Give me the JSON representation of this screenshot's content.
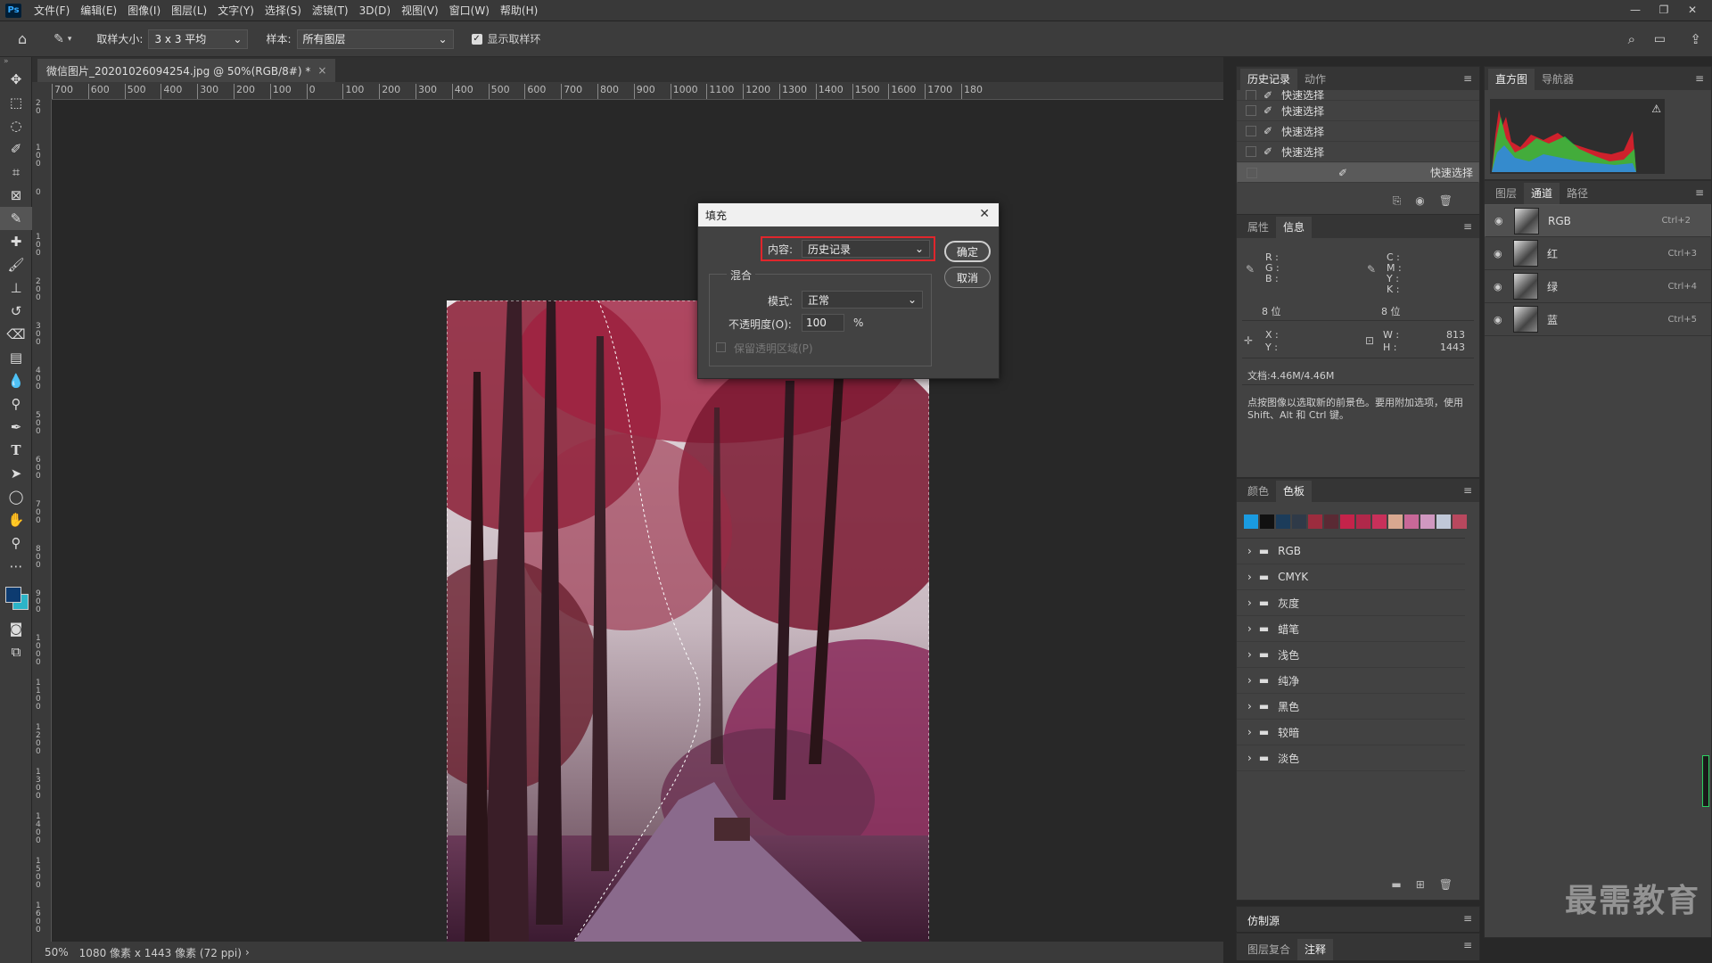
{
  "menubar": {
    "logo": "Ps",
    "items": [
      "文件(F)",
      "编辑(E)",
      "图像(I)",
      "图层(L)",
      "文字(Y)",
      "选择(S)",
      "滤镜(T)",
      "3D(D)",
      "视图(V)",
      "窗口(W)",
      "帮助(H)"
    ]
  },
  "options": {
    "sample_size_label": "取样大小:",
    "sample_size_value": "3 x 3 平均",
    "sample_label": "样本:",
    "sample_value": "所有图层",
    "show_ring_label": "显示取样环"
  },
  "document": {
    "tab_title": "微信图片_20201026094254.jpg @ 50%(RGB/8#) *",
    "close": "×"
  },
  "ruler": {
    "h_labels": [
      "700",
      "600",
      "500",
      "400",
      "300",
      "200",
      "100",
      "0",
      "100",
      "200",
      "300",
      "400",
      "500",
      "600",
      "700",
      "800",
      "900",
      "1000",
      "1100",
      "1200",
      "1300",
      "1400",
      "1500",
      "1600",
      "1700",
      "180"
    ],
    "v_labels": [
      "2 0",
      "1 0 0",
      "0",
      "1 0 0",
      "2 0 0",
      "3 0 0",
      "4 0 0",
      "5 0 0",
      "6 0 0",
      "7 0 0",
      "8 0 0",
      "9 0 0",
      "1 0 0 0",
      "1 1 0 0",
      "1 2 0 0",
      "1 3 0 0",
      "1 4 0 0",
      "1 5 0 0",
      "1 6 0 0"
    ]
  },
  "status": {
    "zoom": "50%",
    "info": "1080 像素 x 1443 像素 (72 ppi)",
    "arrow": "›"
  },
  "history_panel": {
    "tabs": [
      "历史记录",
      "动作"
    ],
    "rows": [
      "快速选择",
      "快速选择",
      "快速选择",
      "快速选择",
      "快速选择"
    ]
  },
  "info_panel": {
    "tabs": [
      "属性",
      "信息"
    ],
    "rgb": [
      "R :",
      "G :",
      "B :"
    ],
    "bit1": "8 位",
    "cmyk": [
      "C :",
      "M :",
      "Y :",
      "K :"
    ],
    "bit2": "8 位",
    "xy": [
      "X :",
      "Y :"
    ],
    "w_label": "W :",
    "w_value": "813",
    "h_label": "H :",
    "h_value": "1443",
    "doc": "文档:4.46M/4.46M",
    "hint": "点按图像以选取新的前景色。要用附加选项，使用 Shift、Alt 和 Ctrl 键。"
  },
  "swatches_panel": {
    "tabs": [
      "颜色",
      "色板"
    ],
    "colors": [
      "#1a9be0",
      "#111111",
      "#1c3c5a",
      "#2f3a48",
      "#9c2c3e",
      "#5a2a34",
      "#c4234a",
      "#b0284a",
      "#c8305a",
      "#d8a890",
      "#c86898",
      "#d098c0",
      "#c0c8d8",
      "#b8485e"
    ],
    "folders": [
      "RGB",
      "CMYK",
      "灰度",
      "蜡笔",
      "浅色",
      "纯净",
      "黑色",
      "较暗",
      "淡色"
    ]
  },
  "clone_panel": {
    "title": "仿制源"
  },
  "bottom_tabs": {
    "tabs": [
      "图层复合",
      "注释"
    ]
  },
  "histogram_panel": {
    "tabs": [
      "直方图",
      "导航器"
    ],
    "warning": "⚠"
  },
  "channels_panel": {
    "tabs": [
      "图层",
      "通道",
      "路径"
    ],
    "rows": [
      {
        "name": "RGB",
        "key": "Ctrl+2"
      },
      {
        "name": "红",
        "key": "Ctrl+3"
      },
      {
        "name": "绿",
        "key": "Ctrl+4"
      },
      {
        "name": "蓝",
        "key": "Ctrl+5"
      }
    ]
  },
  "dialog": {
    "title": "填充",
    "content_label": "内容:",
    "content_value": "历史记录",
    "ok": "确定",
    "cancel": "取消",
    "blend_label": "混合",
    "mode_label": "模式:",
    "mode_value": "正常",
    "opacity_label": "不透明度(O):",
    "opacity_value": "100",
    "opacity_unit": "%",
    "preserve_label": "保留透明区域(P)",
    "highlight_color": "#e0262c"
  },
  "watermark": "最需教育"
}
